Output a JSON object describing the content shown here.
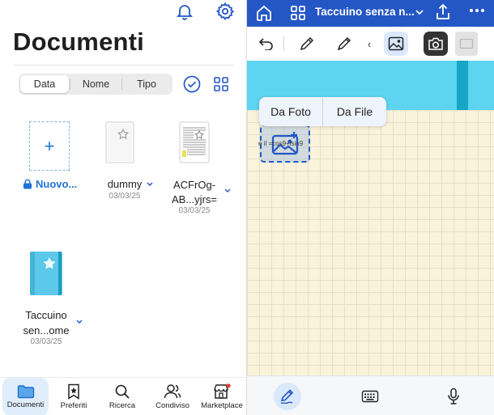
{
  "left": {
    "title": "Documenti",
    "sort_tabs": [
      {
        "label": "Data",
        "active": true
      },
      {
        "label": "Nome",
        "active": false
      },
      {
        "label": "Tipo",
        "active": false
      }
    ],
    "tiles": [
      {
        "name": "Nuovo...",
        "date": ""
      },
      {
        "name": "dummy",
        "date": "03/03/25"
      },
      {
        "name_line1": "ACFrOg-",
        "name_line2": "AB...yjrs=",
        "date": "03/03/25"
      },
      {
        "name_line1": "Taccuino",
        "name_line2": "sen...ome",
        "date": "03/03/25"
      }
    ],
    "nav": [
      {
        "label": "Documenti",
        "icon": "folder-icon",
        "active": true
      },
      {
        "label": "Preferiti",
        "icon": "bookmark-star-icon",
        "active": false
      },
      {
        "label": "Ricerca",
        "icon": "search-icon",
        "active": false
      },
      {
        "label": "Condiviso",
        "icon": "people-icon",
        "active": false
      },
      {
        "label": "Marketplace",
        "icon": "store-icon",
        "active": false,
        "badge": true
      }
    ]
  },
  "right": {
    "title": "Taccuino senza n...",
    "popup": {
      "from_photo": "Da Foto",
      "from_file": "Da File"
    },
    "placeholder_text": "e il =cos9+isin9"
  },
  "colors": {
    "accent": "#2457c5",
    "link_blue": "#1f74d2",
    "banner": "#5dd4f0",
    "paper": "#f9f3dc"
  }
}
